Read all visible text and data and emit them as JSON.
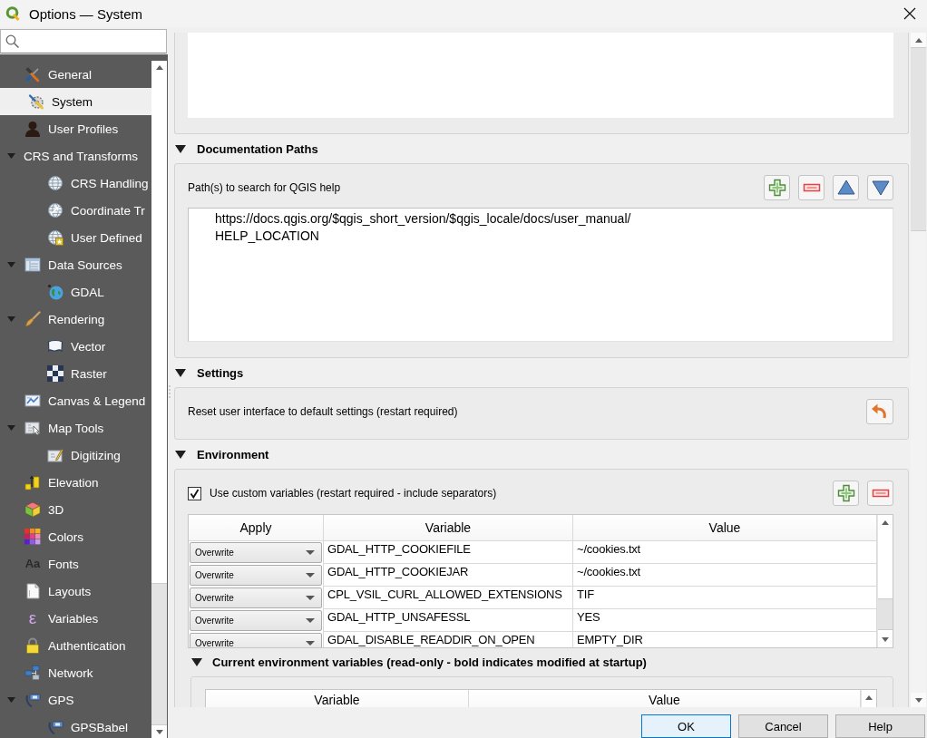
{
  "window": {
    "title": "Options — System"
  },
  "sidebar": {
    "items": [
      {
        "label": "General",
        "selected": false
      },
      {
        "label": "System",
        "selected": true
      },
      {
        "label": "User Profiles",
        "selected": false
      },
      {
        "label": "CRS and Transforms",
        "selected": false,
        "expanded": true,
        "children": [
          {
            "label": "CRS Handling",
            "selected": false
          },
          {
            "label": "Coordinate Tr",
            "selected": false
          },
          {
            "label": "User Defined",
            "selected": false
          }
        ]
      },
      {
        "label": "Data Sources",
        "selected": false,
        "expanded": true,
        "children": [
          {
            "label": "GDAL",
            "selected": false
          }
        ]
      },
      {
        "label": "Rendering",
        "selected": false,
        "expanded": true,
        "children": [
          {
            "label": "Vector",
            "selected": false
          },
          {
            "label": "Raster",
            "selected": false
          }
        ]
      },
      {
        "label": "Canvas & Legend",
        "selected": false
      },
      {
        "label": "Map Tools",
        "selected": false,
        "expanded": true,
        "children": [
          {
            "label": "Digitizing",
            "selected": false
          }
        ]
      },
      {
        "label": "Elevation",
        "selected": false
      },
      {
        "label": "3D",
        "selected": false
      },
      {
        "label": "Colors",
        "selected": false
      },
      {
        "label": "Fonts",
        "selected": false,
        "glyph": "Aa"
      },
      {
        "label": "Layouts",
        "selected": false
      },
      {
        "label": "Variables",
        "selected": false,
        "glyph": "ε"
      },
      {
        "label": "Authentication",
        "selected": false
      },
      {
        "label": "Network",
        "selected": false
      },
      {
        "label": "GPS",
        "selected": false,
        "expanded": true,
        "children": [
          {
            "label": "GPSBabel",
            "selected": false
          }
        ]
      }
    ]
  },
  "sections": [
    {
      "kind": "paths",
      "title": "Documentation Paths",
      "expanded": true,
      "label": "Path(s) to search for QGIS help",
      "paths": [
        "https://docs.qgis.org/$qgis_short_version/$qgis_locale/docs/user_manual/",
        "HELP_LOCATION"
      ]
    },
    {
      "kind": "reset",
      "title": "Settings",
      "expanded": true,
      "label": "Reset user interface to default settings (restart required)"
    },
    {
      "kind": "environment",
      "title": "Environment",
      "expanded": true,
      "custom_variables": {
        "label": "Use custom variables (restart required - include separators)",
        "checked": true
      },
      "table": {
        "columns": [
          "Apply",
          "Variable",
          "Value"
        ],
        "rows": [
          {
            "apply": "Overwrite",
            "variable": "GDAL_HTTP_COOKIEFILE",
            "value": "~/cookies.txt"
          },
          {
            "apply": "Overwrite",
            "variable": "GDAL_HTTP_COOKIEJAR",
            "value": "~/cookies.txt"
          },
          {
            "apply": "Overwrite",
            "variable": "CPL_VSIL_CURL_ALLOWED_EXTENSIONS",
            "value": "TIF"
          },
          {
            "apply": "Overwrite",
            "variable": "GDAL_HTTP_UNSAFESSL",
            "value": "YES"
          },
          {
            "apply": "Overwrite",
            "variable": "GDAL_DISABLE_READDIR_ON_OPEN",
            "value": "EMPTY_DIR"
          }
        ]
      },
      "current": {
        "title": "Current environment variables (read-only - bold indicates modified at startup)",
        "expanded": true,
        "table": {
          "columns": [
            "Variable",
            "Value"
          ]
        }
      }
    }
  ],
  "buttons": [
    {
      "label": "OK",
      "default": true
    },
    {
      "label": "Cancel",
      "default": false
    },
    {
      "label": "Help",
      "default": false
    }
  ]
}
